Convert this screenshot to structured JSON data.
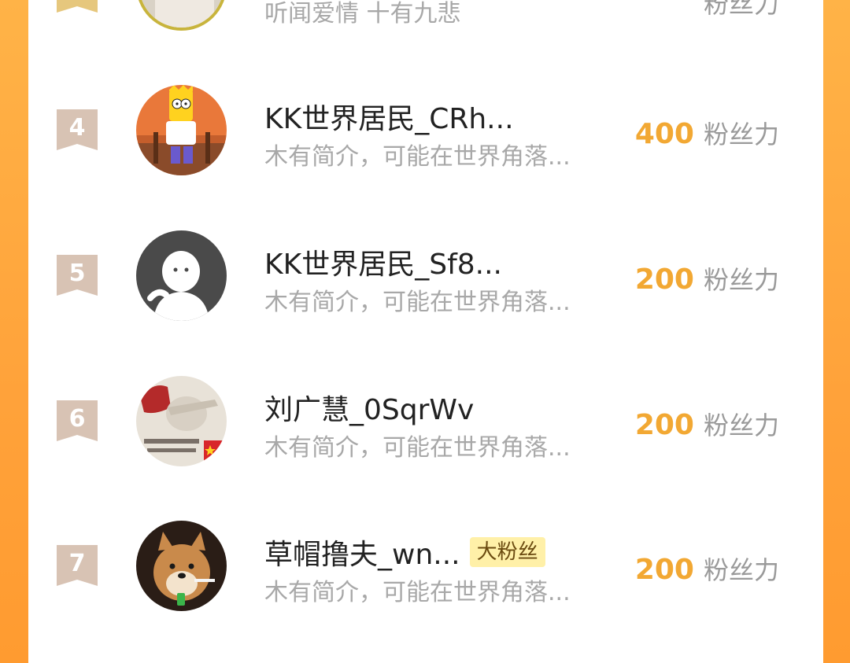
{
  "fan_ranking": {
    "partial_top_row": {
      "bio": "听闻爱情 十有九悲",
      "score_unit": "粉丝力"
    },
    "rows": [
      {
        "rank": "4",
        "name": "KK世界居民_CRh...",
        "bio": "木有简介，可能在世界角落...",
        "score": "400",
        "score_unit": "粉丝力",
        "avatar_icon": "cartoon-avatar-icon"
      },
      {
        "rank": "5",
        "name": "KK世界居民_Sf8...",
        "bio": "木有简介，可能在世界角落...",
        "score": "200",
        "score_unit": "粉丝力",
        "avatar_icon": "default-avatar-icon"
      },
      {
        "rank": "6",
        "name": "刘广慧_0SqrWv",
        "bio": "木有简介，可能在世界角落...",
        "score": "200",
        "score_unit": "粉丝力",
        "avatar_icon": "meme-avatar-icon"
      },
      {
        "rank": "7",
        "name": "草帽撸夫_wn...",
        "badge": "大粉丝",
        "bio": "木有简介，可能在世界角落...",
        "score": "200",
        "score_unit": "粉丝力",
        "avatar_icon": "dog-avatar-icon"
      }
    ]
  },
  "colors": {
    "frame_orange": "#ffa23a",
    "score_gold": "#f2a833",
    "rank_tag": "#d8c3b4",
    "badge_bg": "#fff0a8"
  }
}
